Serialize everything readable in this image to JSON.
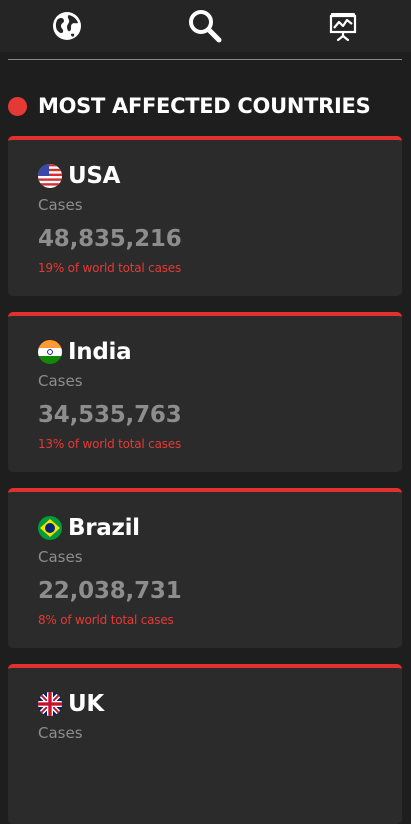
{
  "nav": {
    "icons": [
      "globe-icon",
      "search-icon",
      "presentation-chart-icon"
    ]
  },
  "section": {
    "title": "MOST AFFECTED COUNTRIES"
  },
  "countries": [
    {
      "name": "USA",
      "flag": "usa-flag-icon",
      "cases_label": "Cases",
      "cases": "48,835,216",
      "share": "19% of world total cases"
    },
    {
      "name": "India",
      "flag": "india-flag-icon",
      "cases_label": "Cases",
      "cases": "34,535,763",
      "share": "13% of world total cases"
    },
    {
      "name": "Brazil",
      "flag": "brazil-flag-icon",
      "cases_label": "Cases",
      "cases": "22,038,731",
      "share": "8% of world total cases"
    },
    {
      "name": "UK",
      "flag": "uk-flag-icon",
      "cases_label": "Cases"
    }
  ],
  "colors": {
    "accent": "#e53935",
    "background": "#1e1e1e",
    "card": "#2b2b2b",
    "muted_text": "#8d8d8d"
  }
}
